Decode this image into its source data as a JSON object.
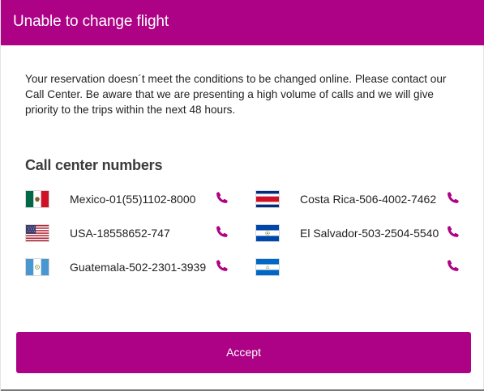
{
  "dialog": {
    "title": "Unable to change flight",
    "message": "Your reservation doesn´t meet the conditions to be changed online. Please contact our Call Center. Be aware that we are presenting a high volume of calls and we will give priority to the trips within the next 48 hours.",
    "section_title": "Call center numbers",
    "accept_label": "Accept"
  },
  "call_centers": [
    {
      "label": "Mexico-01(55)1102-8000",
      "flag": "mexico-flag-icon"
    },
    {
      "label": "Costa Rica-506-4002-7462",
      "flag": "costa-rica-flag-icon"
    },
    {
      "label": "USA-18558652-747",
      "flag": "usa-flag-icon"
    },
    {
      "label": "El Salvador-503-2504-5540",
      "flag": "el-salvador-flag-icon"
    },
    {
      "label": "Guatemala-502-2301-3939",
      "flag": "guatemala-flag-icon"
    },
    {
      "label": "",
      "flag": "nicaragua-flag-icon"
    }
  ],
  "colors": {
    "accent": "#ad0285",
    "text": "#222222",
    "heading": "#3b3b3b"
  },
  "icons": {
    "phone": "phone-icon"
  }
}
